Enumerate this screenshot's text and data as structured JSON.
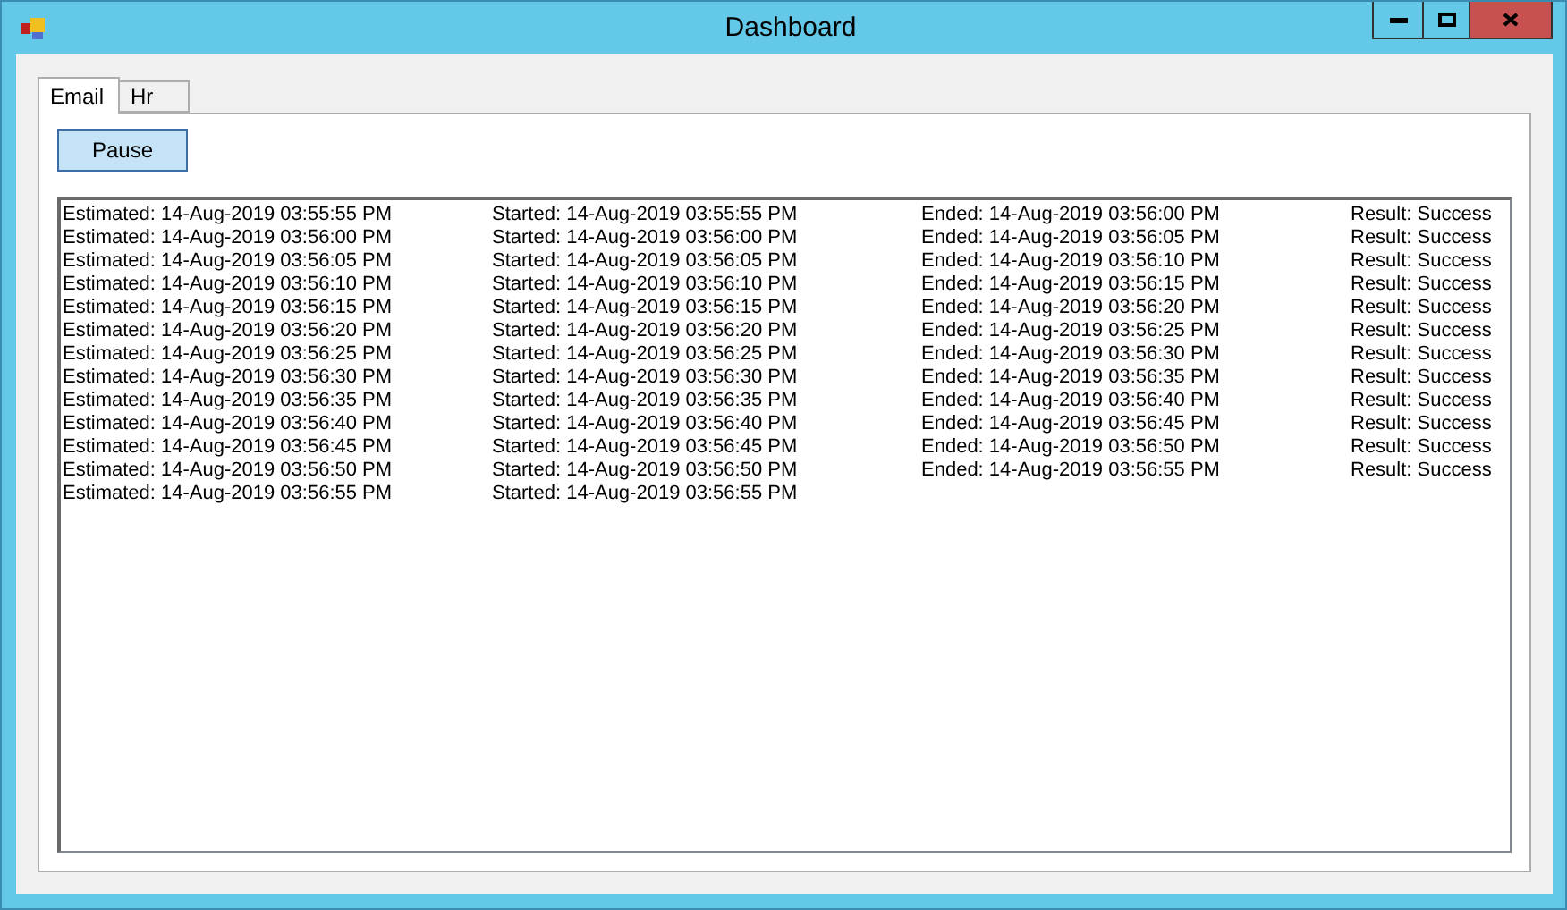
{
  "window": {
    "title": "Dashboard"
  },
  "tabs": [
    {
      "label": "Email",
      "selected": true
    },
    {
      "label": "Hr",
      "selected": false
    }
  ],
  "pause_button": "Pause",
  "log_rows": [
    {
      "estimated": "Estimated: 14-Aug-2019 03:55:55 PM",
      "started": "Started: 14-Aug-2019 03:55:55 PM",
      "ended": "Ended: 14-Aug-2019 03:56:00 PM",
      "result": "Result: Success"
    },
    {
      "estimated": "Estimated: 14-Aug-2019 03:56:00 PM",
      "started": "Started: 14-Aug-2019 03:56:00 PM",
      "ended": "Ended: 14-Aug-2019 03:56:05 PM",
      "result": "Result: Success"
    },
    {
      "estimated": "Estimated: 14-Aug-2019 03:56:05 PM",
      "started": "Started: 14-Aug-2019 03:56:05 PM",
      "ended": "Ended: 14-Aug-2019 03:56:10 PM",
      "result": "Result: Success"
    },
    {
      "estimated": "Estimated: 14-Aug-2019 03:56:10 PM",
      "started": "Started: 14-Aug-2019 03:56:10 PM",
      "ended": "Ended: 14-Aug-2019 03:56:15 PM",
      "result": "Result: Success"
    },
    {
      "estimated": "Estimated: 14-Aug-2019 03:56:15 PM",
      "started": "Started: 14-Aug-2019 03:56:15 PM",
      "ended": "Ended: 14-Aug-2019 03:56:20 PM",
      "result": "Result: Success"
    },
    {
      "estimated": "Estimated: 14-Aug-2019 03:56:20 PM",
      "started": "Started: 14-Aug-2019 03:56:20 PM",
      "ended": "Ended: 14-Aug-2019 03:56:25 PM",
      "result": "Result: Success"
    },
    {
      "estimated": "Estimated: 14-Aug-2019 03:56:25 PM",
      "started": "Started: 14-Aug-2019 03:56:25 PM",
      "ended": "Ended: 14-Aug-2019 03:56:30 PM",
      "result": "Result: Success"
    },
    {
      "estimated": "Estimated: 14-Aug-2019 03:56:30 PM",
      "started": "Started: 14-Aug-2019 03:56:30 PM",
      "ended": "Ended: 14-Aug-2019 03:56:35 PM",
      "result": "Result: Success"
    },
    {
      "estimated": "Estimated: 14-Aug-2019 03:56:35 PM",
      "started": "Started: 14-Aug-2019 03:56:35 PM",
      "ended": "Ended: 14-Aug-2019 03:56:40 PM",
      "result": "Result: Success"
    },
    {
      "estimated": "Estimated: 14-Aug-2019 03:56:40 PM",
      "started": "Started: 14-Aug-2019 03:56:40 PM",
      "ended": "Ended: 14-Aug-2019 03:56:45 PM",
      "result": "Result: Success"
    },
    {
      "estimated": "Estimated: 14-Aug-2019 03:56:45 PM",
      "started": "Started: 14-Aug-2019 03:56:45 PM",
      "ended": "Ended: 14-Aug-2019 03:56:50 PM",
      "result": "Result: Success"
    },
    {
      "estimated": "Estimated: 14-Aug-2019 03:56:50 PM",
      "started": "Started: 14-Aug-2019 03:56:50 PM",
      "ended": "Ended: 14-Aug-2019 03:56:55 PM",
      "result": "Result: Success"
    },
    {
      "estimated": "Estimated: 14-Aug-2019 03:56:55 PM",
      "started": "Started: 14-Aug-2019 03:56:55 PM"
    }
  ]
}
